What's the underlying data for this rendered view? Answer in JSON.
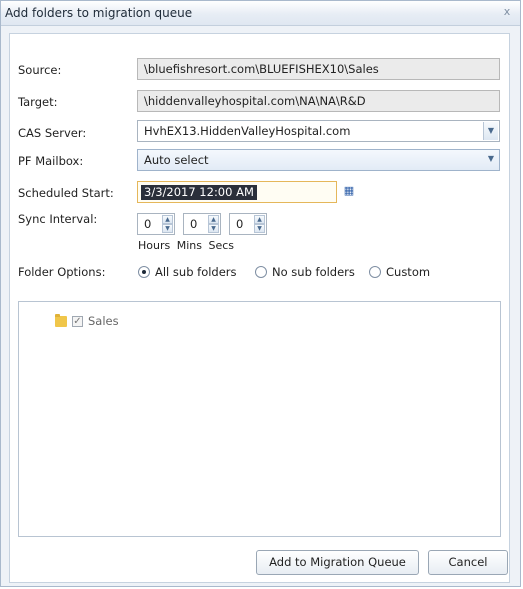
{
  "dialog": {
    "title": "Add folders to migration queue",
    "close_label": "x"
  },
  "form": {
    "source_label": "Source:",
    "source_value": "\\bluefishresort.com\\BLUEFISHEX10\\Sales",
    "target_label": "Target:",
    "target_value": "\\hiddenvalleyhospital.com\\NA\\NA\\R&D",
    "cas_label": "CAS Server:",
    "cas_value": "HvhEX13.HiddenValleyHospital.com",
    "pf_label": "PF Mailbox:",
    "pf_value": "Auto select",
    "start_label": "Scheduled Start:",
    "start_value": "3/3/2017 12:00 AM",
    "sync_label": "Sync Interval:",
    "hours_value": "0",
    "mins_value": "0",
    "secs_value": "0",
    "units_label": "Hours Mins  Secs",
    "folder_options_label": "Folder Options:",
    "options": [
      {
        "label": "All sub folders",
        "selected": true
      },
      {
        "label": "No sub folders",
        "selected": false
      },
      {
        "label": "Custom",
        "selected": false
      }
    ]
  },
  "tree": {
    "items": [
      {
        "label": "Sales",
        "checked": true,
        "icon": "folder-icon"
      }
    ]
  },
  "buttons": {
    "add_label": "Add to Migration Queue",
    "cancel_label": "Cancel"
  },
  "colors": {
    "accent": "#2d5ea8",
    "selection_bg": "#2a2f3a",
    "focus_border": "#e5b75a"
  }
}
